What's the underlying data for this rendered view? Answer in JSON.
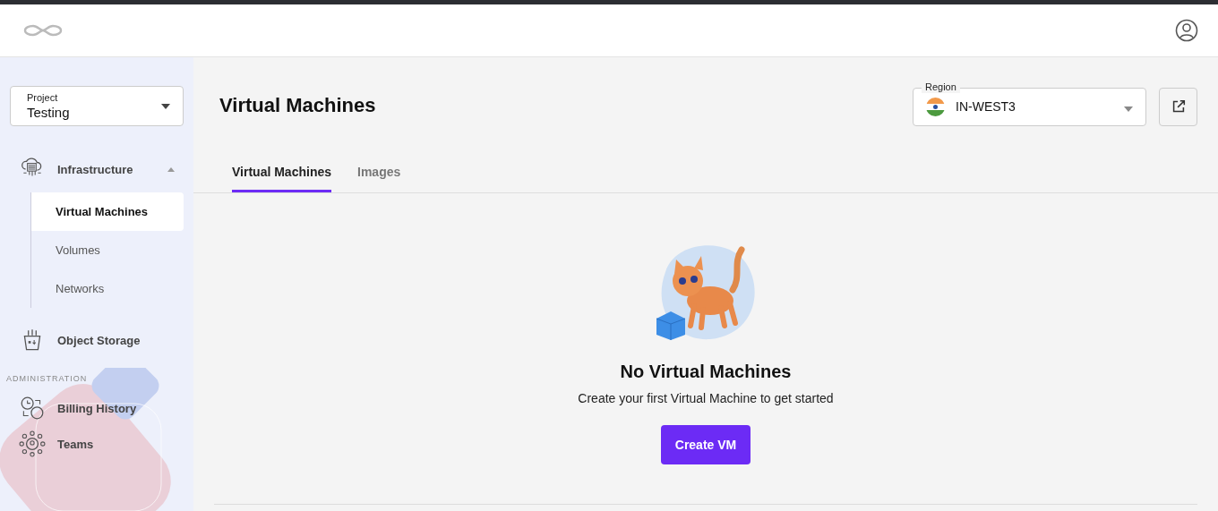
{
  "sidebar": {
    "project": {
      "label": "Project",
      "value": "Testing"
    },
    "nav": [
      {
        "kind": "group",
        "label": "Infrastructure",
        "expanded": true,
        "children": [
          {
            "label": "Virtual Machines",
            "selected": true
          },
          {
            "label": "Volumes",
            "selected": false
          },
          {
            "label": "Networks",
            "selected": false
          }
        ]
      },
      {
        "kind": "item",
        "label": "Object Storage"
      },
      {
        "kind": "section",
        "label": "ADMINISTRATION"
      },
      {
        "kind": "item",
        "label": "Billing History"
      },
      {
        "kind": "item",
        "label": "Teams"
      }
    ]
  },
  "page": {
    "title": "Virtual Machines",
    "region": {
      "label": "Region",
      "value": "IN-WEST3"
    },
    "tabs": [
      {
        "label": "Virtual Machines",
        "selected": true
      },
      {
        "label": "Images",
        "selected": false
      }
    ],
    "empty_state": {
      "title": "No Virtual Machines",
      "text": "Create your first Virtual Machine to get started",
      "button": "Create VM"
    }
  }
}
